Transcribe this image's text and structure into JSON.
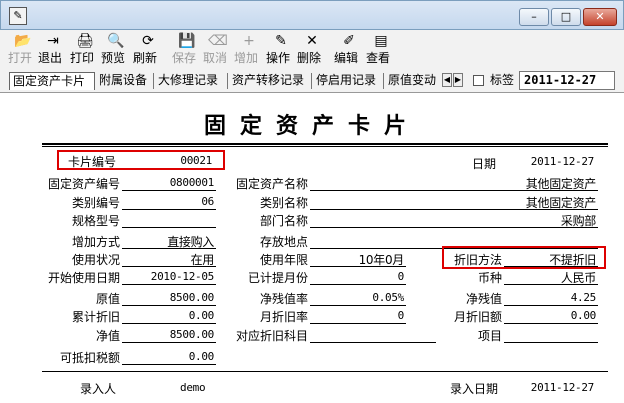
{
  "window": {
    "min": "–",
    "max": "□",
    "close": "✕"
  },
  "toolbar": [
    {
      "label": "打开",
      "icon": "📂",
      "enabled": false
    },
    {
      "label": "退出",
      "icon": "⇥",
      "enabled": true
    },
    {
      "label": "打印",
      "icon": "🖨",
      "enabled": true
    },
    {
      "label": "预览",
      "icon": "🔍",
      "enabled": true
    },
    {
      "label": "刷新",
      "icon": "⟳",
      "enabled": true
    },
    {
      "label": "保存",
      "icon": "💾",
      "enabled": false
    },
    {
      "label": "取消",
      "icon": "⌫",
      "enabled": false
    },
    {
      "label": "增加",
      "icon": "+",
      "enabled": false
    },
    {
      "label": "操作",
      "icon": "✎",
      "enabled": true
    },
    {
      "label": "删除",
      "icon": "✕",
      "enabled": true
    },
    {
      "label": "编辑",
      "icon": "✐",
      "enabled": true
    },
    {
      "label": "查看",
      "icon": "▤",
      "enabled": true
    }
  ],
  "tabs": [
    "固定资产卡片",
    "附属设备",
    "大修理记录",
    "资产转移记录",
    "停启用记录",
    "原值变动"
  ],
  "tag_label": "标签",
  "tag_date": "2011-12-27",
  "card": {
    "title": "固定资产卡片",
    "card_no_label": "卡片编号",
    "card_no": "00021",
    "date_label": "日期",
    "date": "2011-12-27",
    "left": [
      {
        "label": "固定资产编号",
        "value": "0800001"
      },
      {
        "label": "类别编号",
        "value": "06"
      },
      {
        "label": "规格型号",
        "value": ""
      },
      {
        "label": "增加方式",
        "value": "直接购入"
      },
      {
        "label": "使用状况",
        "value": "在用"
      },
      {
        "label": "开始使用日期",
        "value": "2010-12-05"
      },
      {
        "label": "原值",
        "value": "8500.00"
      },
      {
        "label": "累计折旧",
        "value": "0.00"
      },
      {
        "label": "净值",
        "value": "8500.00"
      },
      {
        "label": "可抵扣税额",
        "value": "0.00"
      }
    ],
    "mid": [
      {
        "label": "固定资产名称",
        "value": "其他固定资产"
      },
      {
        "label": "类别名称",
        "value": "其他固定资产"
      },
      {
        "label": "部门名称",
        "value": "采购部"
      },
      {
        "label": "存放地点",
        "value": ""
      },
      {
        "label": "使用年限",
        "value": "10年0月"
      },
      {
        "label": "已计提月份",
        "value": "0"
      },
      {
        "label": "净残值率",
        "value": "0.05%"
      },
      {
        "label": "月折旧率",
        "value": "0"
      },
      {
        "label": "对应折旧科目",
        "value": ""
      }
    ],
    "right": [
      {
        "label": "折旧方法",
        "value": "不提折旧"
      },
      {
        "label": "币种",
        "value": "人民币"
      },
      {
        "label": "净残值",
        "value": "4.25"
      },
      {
        "label": "月折旧额",
        "value": "0.00"
      },
      {
        "label": "项目",
        "value": ""
      }
    ],
    "entered_by_label": "录入人",
    "entered_by": "demo",
    "entry_date_label": "录入日期",
    "entry_date": "2011-12-27"
  }
}
